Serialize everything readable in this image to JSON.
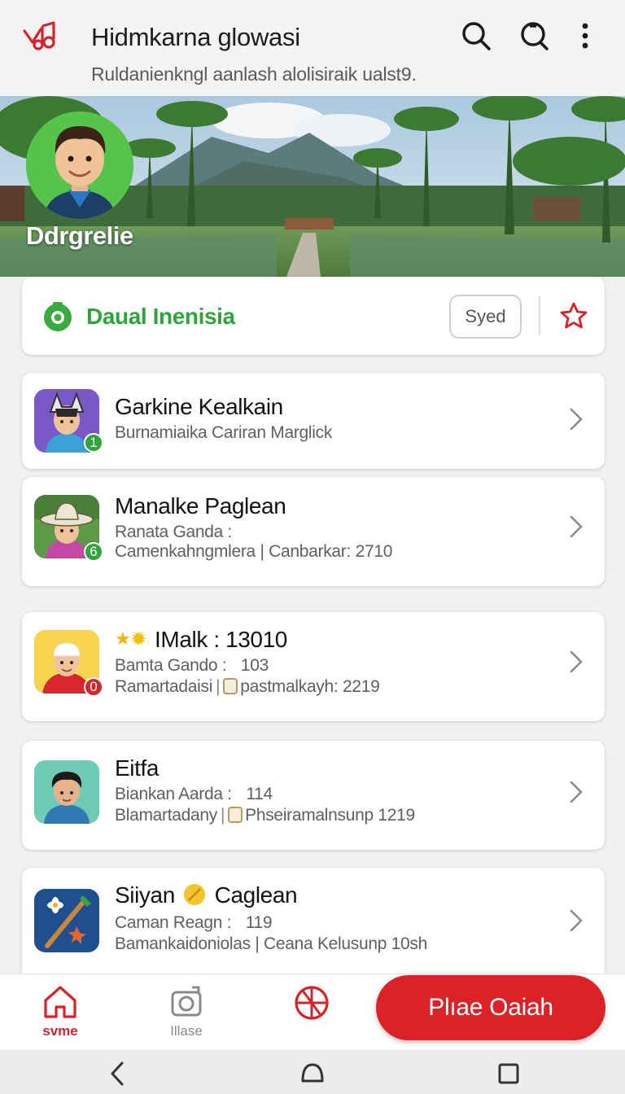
{
  "header": {
    "title": "Hidmkarna glowasi",
    "subtitle": "Ruldanienkngl aanlash alolisiraik ualst9.",
    "icons": [
      "music-logo-icon",
      "search-icon",
      "search-alt-icon",
      "more-vert-icon"
    ]
  },
  "banner": {
    "name": "Ddrgrelie"
  },
  "community": {
    "label": "Daual Inenisia",
    "follow_label": "Syed",
    "accent": "#2ea43a"
  },
  "items": [
    {
      "title": "Garkine Kealkain",
      "line1": "Burnamiaika Cariran Marglick",
      "badge": "1"
    },
    {
      "title": "Manalke Paglean",
      "line1": "Ranata Ganda :",
      "line2": "Camenkahngmlera | Canbarkar: 2710",
      "badge": "6"
    },
    {
      "title": "IMalk : 13010",
      "line1_label": "Bamta Gando :",
      "line1_value": "103",
      "line2_left": "Ramartadaisi",
      "line2_right": "pastmalkayh: 2219",
      "badge": "0"
    },
    {
      "title": "Eitfa",
      "line1_label": "Biankan Aarda :",
      "line1_value": "114",
      "line2_left": "Blamartadany",
      "line2_right": "Phseiramalnsunp 1219"
    },
    {
      "title_a": "Siiyan",
      "title_b": "Caglean",
      "line1_label": "Caman Reagn :",
      "line1_value": "119",
      "line2": "Bamankaidoniolas | Ceana Kelusunp 10sh"
    }
  ],
  "bottom_nav": {
    "home_label": "svme",
    "camera_label": "Illase",
    "primary_button": "Plıae Oaiah"
  },
  "colors": {
    "brand_red": "#dc2127",
    "green": "#2ea43a"
  }
}
